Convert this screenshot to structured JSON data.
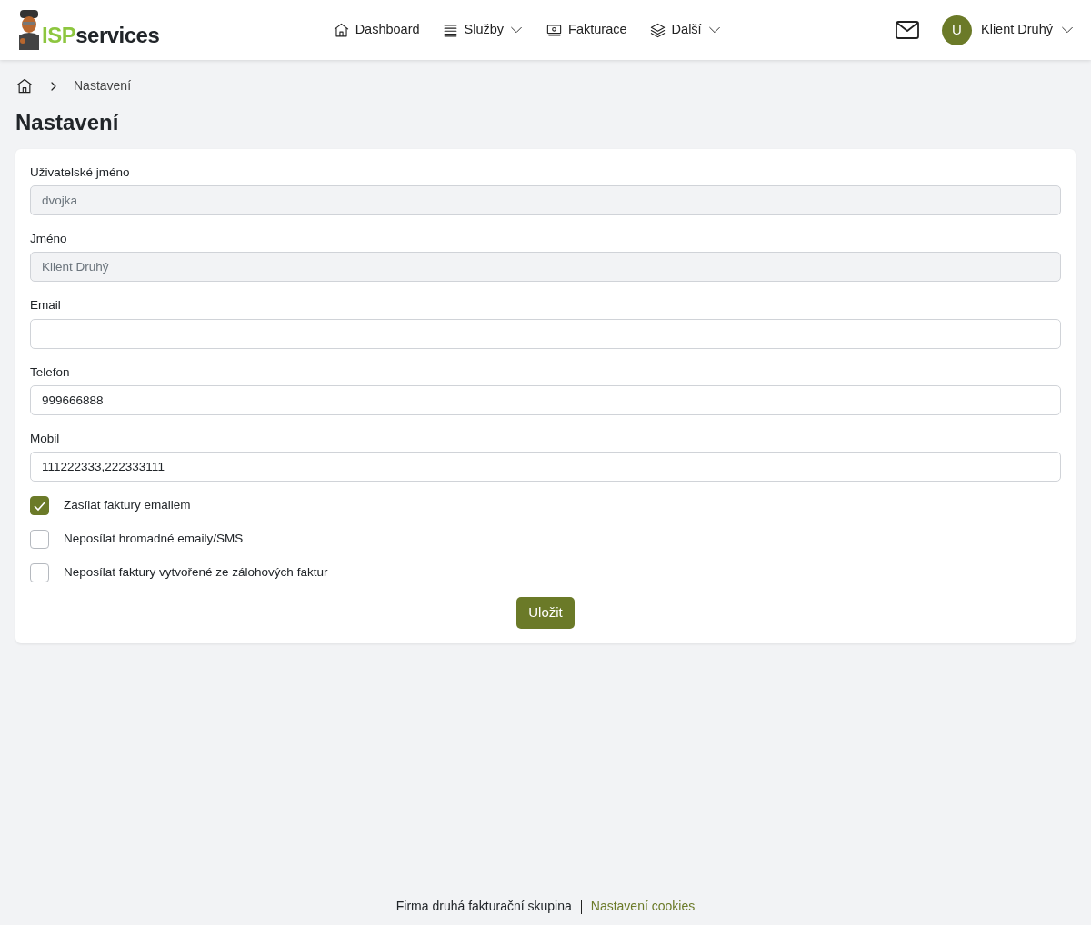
{
  "logo": {
    "prefix": "ISP",
    "suffix": "services"
  },
  "nav": [
    {
      "label": "Dashboard",
      "kind": "home",
      "dropdown": false
    },
    {
      "label": "Služby",
      "kind": "list",
      "dropdown": true
    },
    {
      "label": "Fakturace",
      "kind": "money",
      "dropdown": false
    },
    {
      "label": "Další",
      "kind": "layers",
      "dropdown": true
    }
  ],
  "user": {
    "initial": "U",
    "name": "Klient Druhý"
  },
  "breadcrumb": [
    "Nastavení"
  ],
  "title": "Nastavení",
  "fields": [
    {
      "label": "Uživatelské jméno",
      "value": "dvojka",
      "disabled": true
    },
    {
      "label": "Jméno",
      "value": "Klient Druhý",
      "disabled": true
    },
    {
      "label": "Email",
      "disabled": false
    },
    {
      "label": "Telefon",
      "value": "999666888",
      "disabled": false
    },
    {
      "label": "Mobil",
      "value": "111222333,222333111",
      "disabled": false
    }
  ],
  "checkboxes": [
    {
      "label": "Zasílat faktury emailem",
      "checked": true
    },
    {
      "label": "Neposílat hromadné emaily/SMS",
      "checked": false
    },
    {
      "label": "Neposílat faktury vytvořené ze zálohových faktur",
      "checked": false
    }
  ],
  "save_button": "Uložit",
  "footer": {
    "company": "Firma druhá fakturační skupina",
    "link": "Nastavení cookies"
  }
}
